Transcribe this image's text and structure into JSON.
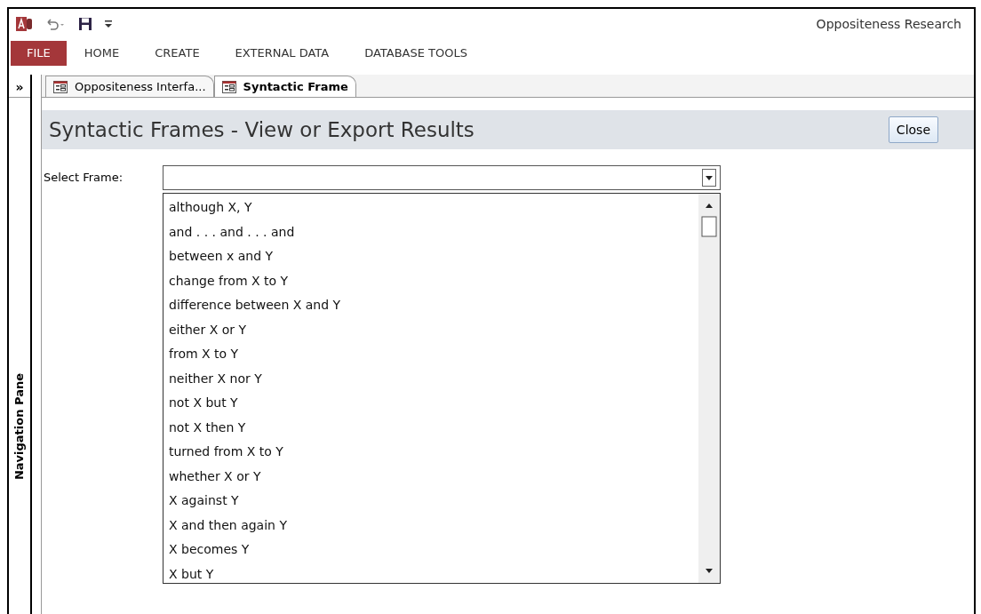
{
  "window": {
    "title": "Oppositeness Research"
  },
  "ribbon_tabs": [
    {
      "label": "FILE",
      "kind": "file"
    },
    {
      "label": "HOME",
      "kind": "tab"
    },
    {
      "label": "CREATE",
      "kind": "tab"
    },
    {
      "label": "EXTERNAL DATA",
      "kind": "tab"
    },
    {
      "label": "DATABASE TOOLS",
      "kind": "tab"
    }
  ],
  "navigation_pane": {
    "toggle": "»",
    "label": "Navigation Pane"
  },
  "document_tabs": [
    {
      "label": "Oppositeness Interfa...",
      "selected": false
    },
    {
      "label": "Syntactic Frame",
      "selected": true
    }
  ],
  "form": {
    "title": "Syntactic Frames - View or Export Results",
    "close_button": "Close",
    "field_label": "Select Frame:",
    "options": [
      "although X, Y",
      "and . . . and . . . and",
      "between x and Y",
      "change from X to Y",
      "difference between X and Y",
      "either X or Y",
      "from X to Y",
      "neither X nor Y",
      "not X but Y",
      "not X then Y",
      "turned from X to Y",
      "whether X or Y",
      "X against Y",
      "X and then again Y",
      "X becomes Y",
      "X but Y"
    ]
  }
}
